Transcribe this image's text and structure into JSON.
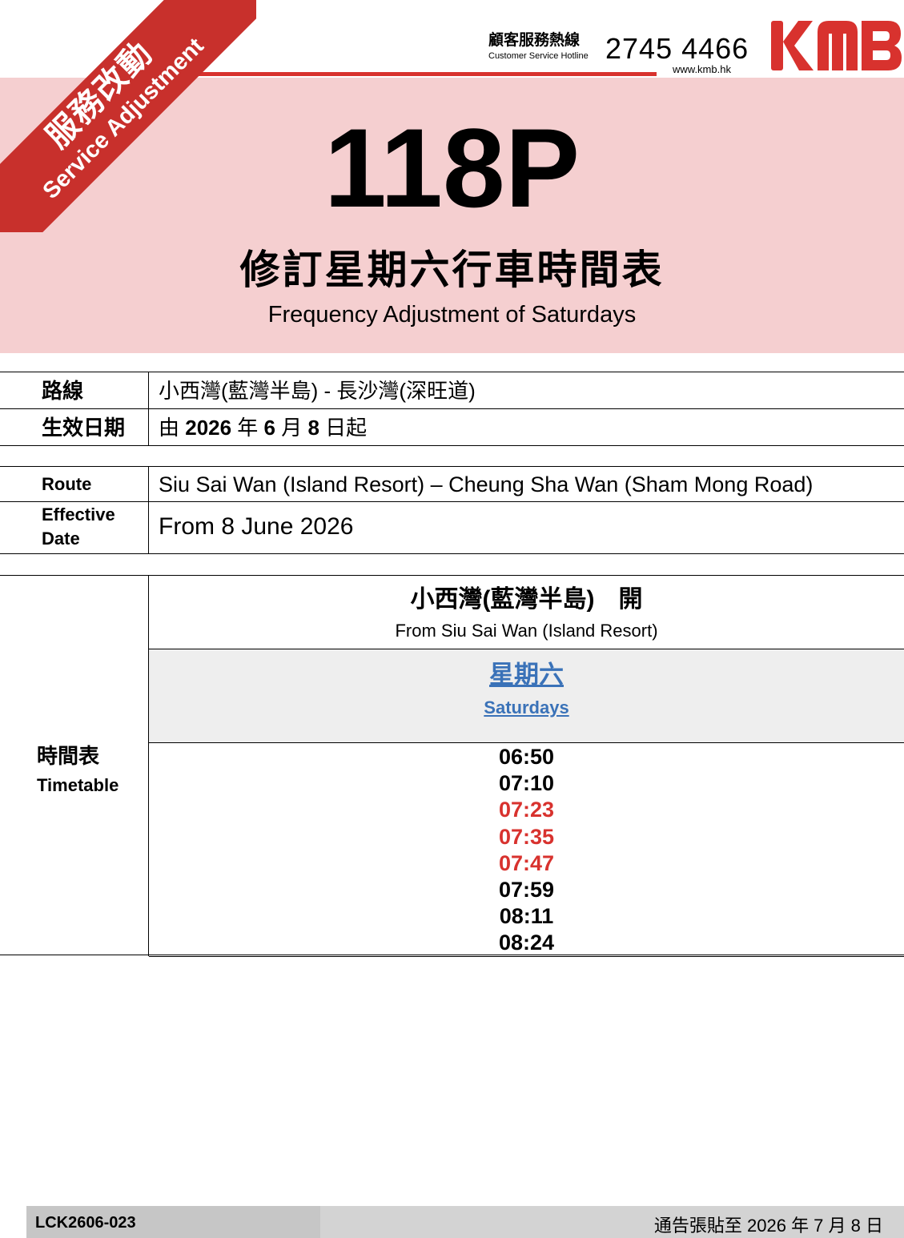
{
  "badge": {
    "zh": "服務改動",
    "en": "Service Adjustment"
  },
  "header": {
    "hotline_zh": "顧客服務熱線",
    "hotline_en": "Customer Service Hotline",
    "phone": "2745 4466",
    "website": "www.kmb.hk",
    "logo_text": "KMB"
  },
  "notice": {
    "route_number": "118P",
    "title_zh": "修訂星期六行車時間表",
    "title_en": "Frequency Adjustment of Saturdays"
  },
  "info_zh": {
    "route_label": "路線",
    "route_value": "小西灣(藍灣半島) - 長沙灣(深旺道)",
    "date_label": "生效日期",
    "date_value": {
      "p1": "由 ",
      "year": "2026",
      "p2": " 年 ",
      "month": "6",
      "p3": " 月 ",
      "day": "8",
      "p4": " 日起"
    }
  },
  "info_en": {
    "route_label": "Route",
    "route_value": "Siu Sai Wan (Island Resort) – Cheung Sha Wan (Sham Mong Road)",
    "date_label_1": "Effective",
    "date_label_2": "Date",
    "date_value": "From 8 June 2026"
  },
  "timetable": {
    "label_zh": "時間表",
    "label_en": "Timetable",
    "from_zh": "小西灣(藍灣半島)　開",
    "from_en": "From Siu Sai Wan (Island Resort)",
    "day_zh": "星期六",
    "day_en": "Saturdays",
    "times": [
      {
        "t": "06:50",
        "changed": false
      },
      {
        "t": "07:10",
        "changed": false
      },
      {
        "t": "07:23",
        "changed": true
      },
      {
        "t": "07:35",
        "changed": true
      },
      {
        "t": "07:47",
        "changed": true
      },
      {
        "t": "07:59",
        "changed": false
      },
      {
        "t": "08:11",
        "changed": false
      },
      {
        "t": "08:24",
        "changed": false
      }
    ],
    "changed_color": "#d8322e",
    "day_color": "#3a72b8"
  },
  "footer": {
    "code": "LCK2606-023",
    "note": "通告張貼至 2026 年 7 月 8 日"
  },
  "brand_color": "#d8322e",
  "banner_color": "#f5cfd0"
}
